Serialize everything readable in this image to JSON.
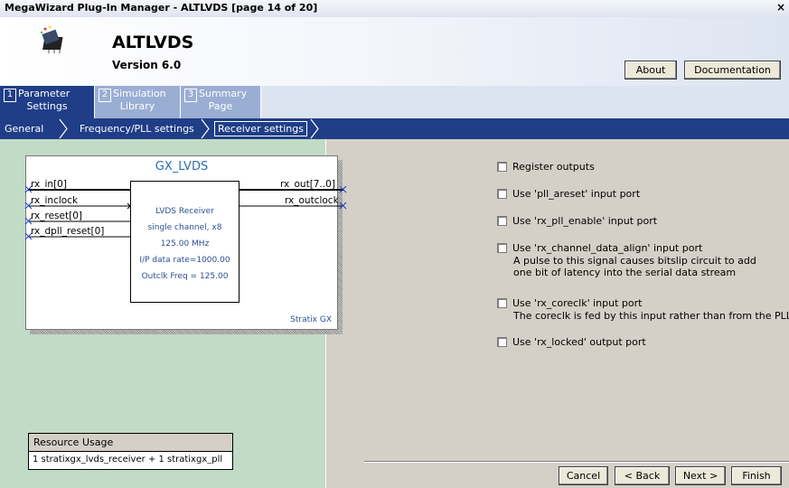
{
  "window": {
    "title": "MegaWizard Plug-In Manager - ALTLVDS [page 14 of 20]",
    "close": "×"
  },
  "header": {
    "app_name": "ALTLVDS",
    "version": "Version 6.0",
    "about_label": "About",
    "documentation_label": "Documentation"
  },
  "tabs": [
    {
      "num": "1",
      "line1": "Parameter",
      "line2": "Settings"
    },
    {
      "num": "2",
      "line1": "Simulation",
      "line2": "Library"
    },
    {
      "num": "3",
      "line1": "Summary",
      "line2": "Page"
    }
  ],
  "breadcrumb": [
    "General",
    "Frequency/PLL settings",
    "Receiver settings"
  ],
  "diagram": {
    "title": "GX_LVDS",
    "inputs": [
      "rx_in[0]",
      "rx_inclock",
      "rx_reset[0]",
      "rx_dpll_reset[0]"
    ],
    "outputs": [
      "rx_out[7..0]",
      "rx_outclock"
    ],
    "block_lines": [
      "LVDS Receiver",
      "single channel, x8",
      "125.00 MHz",
      "I/P data rate=1000.00",
      "Outclk Freq = 125.00"
    ],
    "family": "Stratix GX"
  },
  "resource": {
    "label": "Resource Usage",
    "value": "1 stratixgx_lvds_receiver + 1 stratixgx_pll"
  },
  "options": [
    {
      "label": "Register outputs",
      "desc": [],
      "checked": false
    },
    {
      "label": "Use 'pll_areset' input port",
      "desc": [],
      "checked": false
    },
    {
      "label": "Use 'rx_pll_enable' input port",
      "desc": [],
      "checked": false
    },
    {
      "label": "Use 'rx_channel_data_align' input port",
      "desc": [
        "A pulse to this signal causes bitslip circuit to add",
        "one bit of latency into the serial data stream"
      ],
      "checked": false
    },
    {
      "label": "Use 'rx_coreclk' input port",
      "desc": [
        "The coreclk is fed by this input rather than from the PLL"
      ],
      "checked": false
    },
    {
      "label": "Use 'rx_locked' output port",
      "desc": [],
      "checked": false
    }
  ],
  "footer": {
    "cancel": "Cancel",
    "back": "< Back",
    "next": "Next >",
    "finish": "Finish"
  }
}
